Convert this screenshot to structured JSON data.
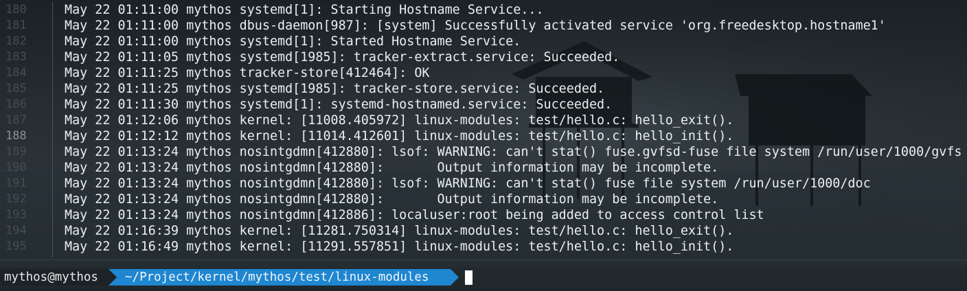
{
  "colors": {
    "background": "#1c2226",
    "text": "#eceff1",
    "line_number": "#454d52",
    "line_number_current": "#8a9196",
    "prompt_user_bg": "#1d2227",
    "prompt_path_bg": "#1f86d0",
    "cursor": "#ffffff"
  },
  "gutter": {
    "line_numbers": [
      "180",
      "181",
      "182",
      "183",
      "184",
      "185",
      "186",
      "187",
      "188",
      "189",
      "190",
      "191",
      "192",
      "193",
      "194",
      "195"
    ]
  },
  "log": {
    "lines": [
      "May 22 01:11:00 mythos systemd[1]: Starting Hostname Service...",
      "May 22 01:11:00 mythos dbus-daemon[987]: [system] Successfully activated service 'org.freedesktop.hostname1'",
      "May 22 01:11:00 mythos systemd[1]: Started Hostname Service.",
      "May 22 01:11:05 mythos systemd[1985]: tracker-extract.service: Succeeded.",
      "May 22 01:11:25 mythos tracker-store[412464]: OK",
      "May 22 01:11:25 mythos systemd[1985]: tracker-store.service: Succeeded.",
      "May 22 01:11:30 mythos systemd[1]: systemd-hostnamed.service: Succeeded.",
      "May 22 01:12:06 mythos kernel: [11008.405972] linux-modules: test/hello.c: hello_exit().",
      "May 22 01:12:12 mythos kernel: [11014.412601] linux-modules: test/hello.c: hello_init().",
      "May 22 01:13:24 mythos nosintgdmn[412880]: lsof: WARNING: can't stat() fuse.gvfsd-fuse file system /run/user/1000/gvfs",
      "May 22 01:13:24 mythos nosintgdmn[412880]:       Output information may be incomplete.",
      "May 22 01:13:24 mythos nosintgdmn[412880]: lsof: WARNING: can't stat() fuse file system /run/user/1000/doc",
      "May 22 01:13:24 mythos nosintgdmn[412880]:       Output information may be incomplete.",
      "May 22 01:13:24 mythos nosintgdmn[412886]: localuser:root being added to access control list",
      "May 22 01:16:39 mythos kernel: [11281.750314] linux-modules: test/hello.c: hello_exit().",
      "May 22 01:16:49 mythos kernel: [11291.557851] linux-modules: test/hello.c: hello_init()."
    ]
  },
  "prompt": {
    "user_host": "mythos@mythos",
    "path": "~/Project/kernel/mythos/test/linux-modules"
  }
}
